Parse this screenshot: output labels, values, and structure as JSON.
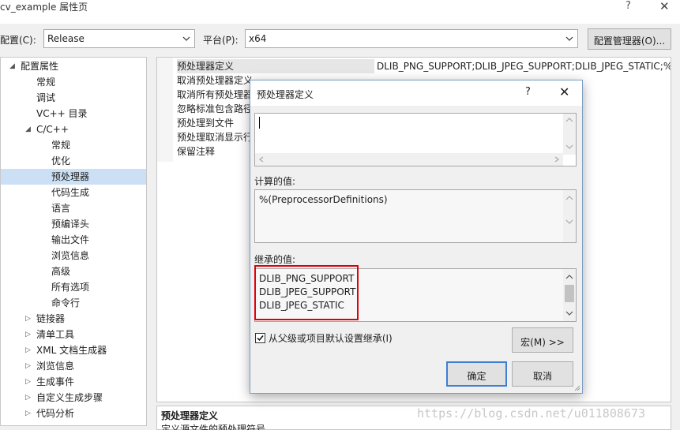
{
  "window": {
    "title": "cv_example 属性页",
    "help": "?",
    "close": "✕"
  },
  "config": {
    "config_label": "配置(C):",
    "config_value": "Release",
    "platform_label": "平台(P):",
    "platform_value": "x64",
    "manager_button": "配置管理器(O)..."
  },
  "tree": {
    "items": [
      {
        "label": "配置属性",
        "expander": "◢"
      },
      {
        "label": "常规"
      },
      {
        "label": "调试"
      },
      {
        "label": "VC++ 目录"
      },
      {
        "label": "C/C++",
        "expander": "◢"
      },
      {
        "label": "常规"
      },
      {
        "label": "优化"
      },
      {
        "label": "预处理器"
      },
      {
        "label": "代码生成"
      },
      {
        "label": "语言"
      },
      {
        "label": "预编译头"
      },
      {
        "label": "输出文件"
      },
      {
        "label": "浏览信息"
      },
      {
        "label": "高级"
      },
      {
        "label": "所有选项"
      },
      {
        "label": "命令行"
      },
      {
        "label": "链接器",
        "expander": "▷"
      },
      {
        "label": "清单工具",
        "expander": "▷"
      },
      {
        "label": "XML 文档生成器",
        "expander": "▷"
      },
      {
        "label": "浏览信息",
        "expander": "▷"
      },
      {
        "label": "生成事件",
        "expander": "▷"
      },
      {
        "label": "自定义生成步骤",
        "expander": "▷"
      },
      {
        "label": "代码分析",
        "expander": "▷"
      }
    ]
  },
  "grid": {
    "rows": [
      {
        "name": "预处理器定义",
        "value": "DLIB_PNG_SUPPORT;DLIB_JPEG_SUPPORT;DLIB_JPEG_STATIC;%(Pr"
      },
      {
        "name": "取消预处理器定义",
        "value": ""
      },
      {
        "name": "取消所有预处理器",
        "value": ""
      },
      {
        "name": "忽略标准包含路径",
        "value": ""
      },
      {
        "name": "预处理到文件",
        "value": ""
      },
      {
        "name": "预处理取消显示行",
        "value": ""
      },
      {
        "name": "保留注释",
        "value": ""
      }
    ]
  },
  "description": {
    "title": "预处理器定义",
    "text": "定义源文件的预处理符号"
  },
  "watermark": "https://blog.csdn.net/u011808673",
  "dialog": {
    "title": "预处理器定义",
    "help": "?",
    "close": "✕",
    "edit_value": "",
    "computed_label": "计算的值:",
    "computed_value": "%(PreprocessorDefinitions)",
    "inherited_label": "继承的值:",
    "inherited_values": [
      "DLIB_PNG_SUPPORT",
      "DLIB_JPEG_SUPPORT",
      "DLIB_JPEG_STATIC"
    ],
    "inherit_checkbox": "从父级或项目默认设置继承(I)",
    "inherit_checked": true,
    "macro_button": "宏(M) >>",
    "ok_button": "确定",
    "cancel_button": "取消"
  },
  "colors": {
    "highlight": "#e0000b",
    "selection": "#cce0f5",
    "focus_border": "#3c7fd4"
  },
  "icons": [
    "chevron-down-icon",
    "tree-expanded-icon",
    "tree-collapsed-icon",
    "check-icon",
    "scroll-up-icon",
    "scroll-down-icon"
  ]
}
